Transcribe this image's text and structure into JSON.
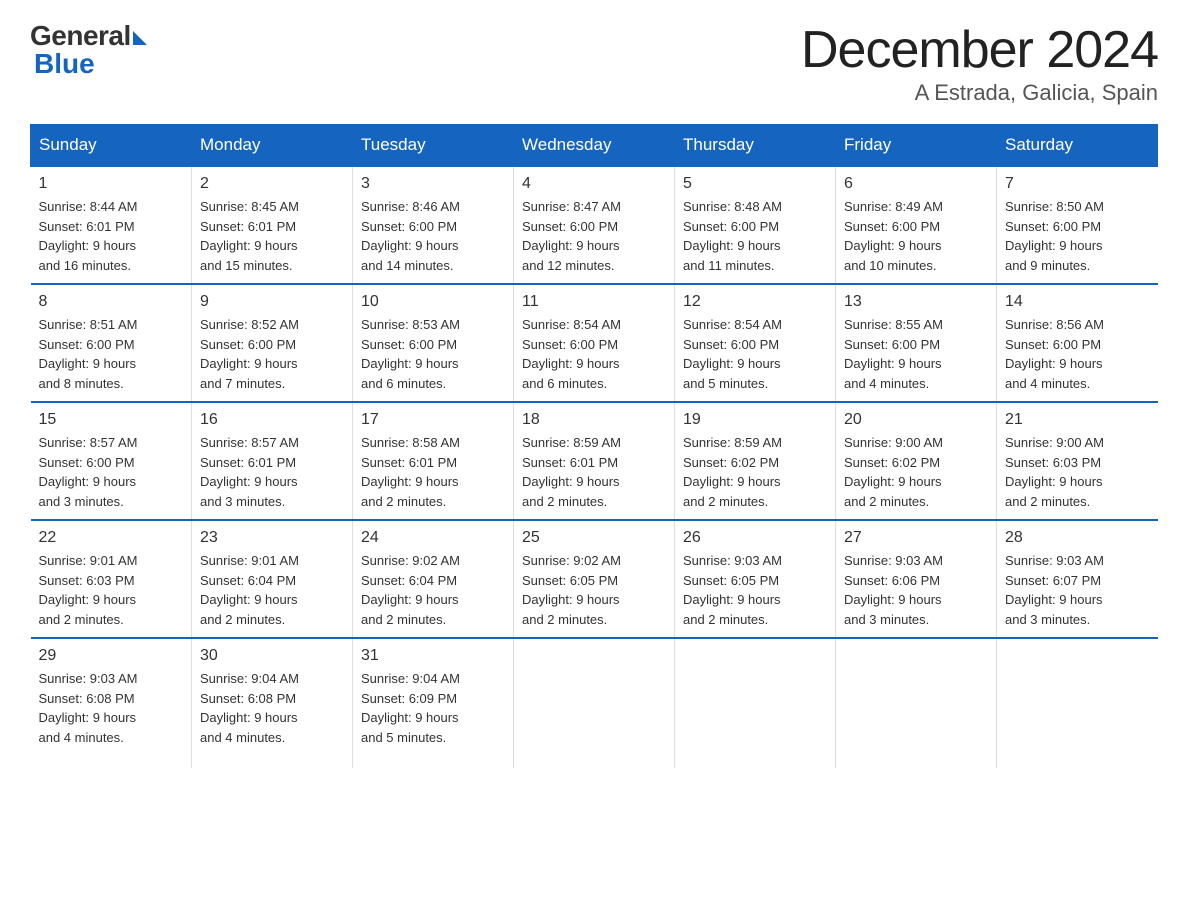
{
  "header": {
    "logo_general": "General",
    "logo_blue": "Blue",
    "title": "December 2024",
    "subtitle": "A Estrada, Galicia, Spain"
  },
  "days_of_week": [
    "Sunday",
    "Monday",
    "Tuesday",
    "Wednesday",
    "Thursday",
    "Friday",
    "Saturday"
  ],
  "weeks": [
    [
      {
        "day": "1",
        "sunrise": "8:44 AM",
        "sunset": "6:01 PM",
        "daylight": "9 hours and 16 minutes."
      },
      {
        "day": "2",
        "sunrise": "8:45 AM",
        "sunset": "6:01 PM",
        "daylight": "9 hours and 15 minutes."
      },
      {
        "day": "3",
        "sunrise": "8:46 AM",
        "sunset": "6:00 PM",
        "daylight": "9 hours and 14 minutes."
      },
      {
        "day": "4",
        "sunrise": "8:47 AM",
        "sunset": "6:00 PM",
        "daylight": "9 hours and 12 minutes."
      },
      {
        "day": "5",
        "sunrise": "8:48 AM",
        "sunset": "6:00 PM",
        "daylight": "9 hours and 11 minutes."
      },
      {
        "day": "6",
        "sunrise": "8:49 AM",
        "sunset": "6:00 PM",
        "daylight": "9 hours and 10 minutes."
      },
      {
        "day": "7",
        "sunrise": "8:50 AM",
        "sunset": "6:00 PM",
        "daylight": "9 hours and 9 minutes."
      }
    ],
    [
      {
        "day": "8",
        "sunrise": "8:51 AM",
        "sunset": "6:00 PM",
        "daylight": "9 hours and 8 minutes."
      },
      {
        "day": "9",
        "sunrise": "8:52 AM",
        "sunset": "6:00 PM",
        "daylight": "9 hours and 7 minutes."
      },
      {
        "day": "10",
        "sunrise": "8:53 AM",
        "sunset": "6:00 PM",
        "daylight": "9 hours and 6 minutes."
      },
      {
        "day": "11",
        "sunrise": "8:54 AM",
        "sunset": "6:00 PM",
        "daylight": "9 hours and 6 minutes."
      },
      {
        "day": "12",
        "sunrise": "8:54 AM",
        "sunset": "6:00 PM",
        "daylight": "9 hours and 5 minutes."
      },
      {
        "day": "13",
        "sunrise": "8:55 AM",
        "sunset": "6:00 PM",
        "daylight": "9 hours and 4 minutes."
      },
      {
        "day": "14",
        "sunrise": "8:56 AM",
        "sunset": "6:00 PM",
        "daylight": "9 hours and 4 minutes."
      }
    ],
    [
      {
        "day": "15",
        "sunrise": "8:57 AM",
        "sunset": "6:00 PM",
        "daylight": "9 hours and 3 minutes."
      },
      {
        "day": "16",
        "sunrise": "8:57 AM",
        "sunset": "6:01 PM",
        "daylight": "9 hours and 3 minutes."
      },
      {
        "day": "17",
        "sunrise": "8:58 AM",
        "sunset": "6:01 PM",
        "daylight": "9 hours and 2 minutes."
      },
      {
        "day": "18",
        "sunrise": "8:59 AM",
        "sunset": "6:01 PM",
        "daylight": "9 hours and 2 minutes."
      },
      {
        "day": "19",
        "sunrise": "8:59 AM",
        "sunset": "6:02 PM",
        "daylight": "9 hours and 2 minutes."
      },
      {
        "day": "20",
        "sunrise": "9:00 AM",
        "sunset": "6:02 PM",
        "daylight": "9 hours and 2 minutes."
      },
      {
        "day": "21",
        "sunrise": "9:00 AM",
        "sunset": "6:03 PM",
        "daylight": "9 hours and 2 minutes."
      }
    ],
    [
      {
        "day": "22",
        "sunrise": "9:01 AM",
        "sunset": "6:03 PM",
        "daylight": "9 hours and 2 minutes."
      },
      {
        "day": "23",
        "sunrise": "9:01 AM",
        "sunset": "6:04 PM",
        "daylight": "9 hours and 2 minutes."
      },
      {
        "day": "24",
        "sunrise": "9:02 AM",
        "sunset": "6:04 PM",
        "daylight": "9 hours and 2 minutes."
      },
      {
        "day": "25",
        "sunrise": "9:02 AM",
        "sunset": "6:05 PM",
        "daylight": "9 hours and 2 minutes."
      },
      {
        "day": "26",
        "sunrise": "9:03 AM",
        "sunset": "6:05 PM",
        "daylight": "9 hours and 2 minutes."
      },
      {
        "day": "27",
        "sunrise": "9:03 AM",
        "sunset": "6:06 PM",
        "daylight": "9 hours and 3 minutes."
      },
      {
        "day": "28",
        "sunrise": "9:03 AM",
        "sunset": "6:07 PM",
        "daylight": "9 hours and 3 minutes."
      }
    ],
    [
      {
        "day": "29",
        "sunrise": "9:03 AM",
        "sunset": "6:08 PM",
        "daylight": "9 hours and 4 minutes."
      },
      {
        "day": "30",
        "sunrise": "9:04 AM",
        "sunset": "6:08 PM",
        "daylight": "9 hours and 4 minutes."
      },
      {
        "day": "31",
        "sunrise": "9:04 AM",
        "sunset": "6:09 PM",
        "daylight": "9 hours and 5 minutes."
      },
      null,
      null,
      null,
      null
    ]
  ],
  "labels": {
    "sunrise": "Sunrise:",
    "sunset": "Sunset:",
    "daylight": "Daylight:"
  }
}
